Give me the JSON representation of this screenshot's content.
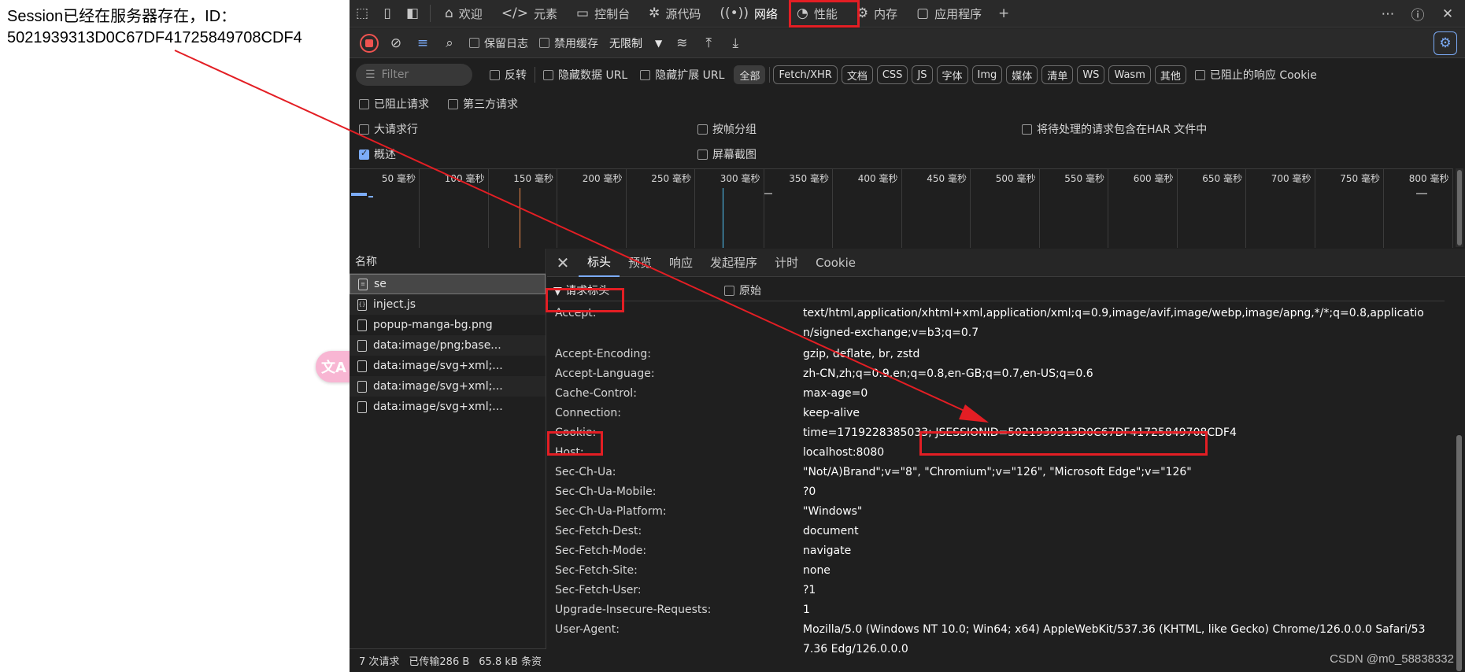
{
  "page": {
    "session_text": "Session已经在服务器存在，ID：5021939313D0C67DF41725849708CDF4",
    "translate_glyph": "文A"
  },
  "main_tabs": [
    {
      "label": "欢迎",
      "icon": "⌂"
    },
    {
      "label": "元素",
      "icon": "</>"
    },
    {
      "label": "控制台",
      "icon": "▭"
    },
    {
      "label": "源代码",
      "icon": "✲"
    },
    {
      "label": "网络",
      "icon": "((•))"
    },
    {
      "label": "性能",
      "icon": "◔"
    },
    {
      "label": "内存",
      "icon": "⚙"
    },
    {
      "label": "应用程序",
      "icon": "▢"
    }
  ],
  "toolbar": {
    "preserve_log": "保留日志",
    "disable_cache": "禁用缓存",
    "throttle": "无限制"
  },
  "filter": {
    "placeholder": "Filter",
    "invert": "反转",
    "hide_data_urls": "隐藏数据 URL",
    "hide_ext_urls": "隐藏扩展 URL",
    "types": [
      "全部",
      "Fetch/XHR",
      "文档",
      "CSS",
      "JS",
      "字体",
      "Img",
      "媒体",
      "清单",
      "WS",
      "Wasm",
      "其他"
    ],
    "blocked_cookies": "已阻止的响应 Cookie",
    "blocked_requests": "已阻止请求",
    "third_party": "第三方请求"
  },
  "options": {
    "big_rows": "大请求行",
    "group_by_frame": "按帧分组",
    "include_pending_har": "将待处理的请求包含在HAR 文件中",
    "overview": "概述",
    "screenshots": "屏幕截图"
  },
  "timeline_labels": [
    "50 毫秒",
    "100 毫秒",
    "150 毫秒",
    "200 毫秒",
    "250 毫秒",
    "300 毫秒",
    "350 毫秒",
    "400 毫秒",
    "450 毫秒",
    "500 毫秒",
    "550 毫秒",
    "600 毫秒",
    "650 毫秒",
    "700 毫秒",
    "750 毫秒",
    "800 毫秒"
  ],
  "request_list": {
    "header": "名称",
    "rows": [
      "se",
      "inject.js",
      "popup-manga-bg.png",
      "data:image/png;base...",
      "data:image/svg+xml;...",
      "data:image/svg+xml;...",
      "data:image/svg+xml;..."
    ],
    "status": [
      "7 次请求",
      "已传输286 B",
      "65.8 kB 条资"
    ]
  },
  "detail_tabs": [
    "标头",
    "预览",
    "响应",
    "发起程序",
    "计时",
    "Cookie"
  ],
  "request_headers": {
    "title": "▼ 请求标头",
    "raw_label": "原始",
    "rows": [
      {
        "name": "Accept:",
        "value": "text/html,application/xhtml+xml,application/xml;q=0.9,image/avif,image/webp,image/apng,*/*;q=0.8,application/signed-exchange;v=b3;q=0.7"
      },
      {
        "name": "Accept-Encoding:",
        "value": "gzip, deflate, br, zstd"
      },
      {
        "name": "Accept-Language:",
        "value": "zh-CN,zh;q=0.9,en;q=0.8,en-GB;q=0.7,en-US;q=0.6"
      },
      {
        "name": "Cache-Control:",
        "value": "max-age=0"
      },
      {
        "name": "Connection:",
        "value": "keep-alive"
      },
      {
        "name": "Cookie:",
        "value": "time=1719228385033; JSESSIONID=5021939313D0C67DF41725849708CDF4"
      },
      {
        "name": "Host:",
        "value": "localhost:8080"
      },
      {
        "name": "Sec-Ch-Ua:",
        "value": "\"Not/A)Brand\";v=\"8\", \"Chromium\";v=\"126\", \"Microsoft Edge\";v=\"126\""
      },
      {
        "name": "Sec-Ch-Ua-Mobile:",
        "value": "?0"
      },
      {
        "name": "Sec-Ch-Ua-Platform:",
        "value": "\"Windows\""
      },
      {
        "name": "Sec-Fetch-Dest:",
        "value": "document"
      },
      {
        "name": "Sec-Fetch-Mode:",
        "value": "navigate"
      },
      {
        "name": "Sec-Fetch-Site:",
        "value": "none"
      },
      {
        "name": "Sec-Fetch-User:",
        "value": "?1"
      },
      {
        "name": "Upgrade-Insecure-Requests:",
        "value": "1"
      },
      {
        "name": "User-Agent:",
        "value": "Mozilla/5.0 (Windows NT 10.0; Win64; x64) AppleWebKit/537.36 (KHTML, like Gecko) Chrome/126.0.0.0 Safari/537.36 Edg/126.0.0.0"
      }
    ]
  },
  "watermark": "CSDN @m0_58838332",
  "colors": {
    "annotation_red": "#e31e24",
    "accent_blue": "#7cacf8",
    "record_red": "#ef5350"
  }
}
